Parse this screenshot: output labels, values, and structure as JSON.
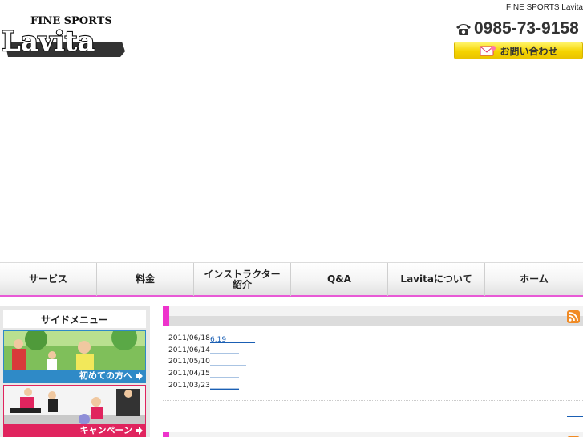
{
  "header": {
    "brand_text": "FINE SPORTS Lavita",
    "logo": {
      "top_text": "FINE SPORTS",
      "main_text": "Lavita"
    },
    "phone": "0985-73-9158",
    "phone_icon": "telephone-icon",
    "contact_label": "お問い合わせ",
    "contact_icon": "mail-icon"
  },
  "nav": {
    "items": [
      {
        "label": "サービス"
      },
      {
        "label": "料金"
      },
      {
        "label": "インストラクター\n紹介"
      },
      {
        "label": "Q&A"
      },
      {
        "label": "Lavitaについて"
      },
      {
        "label": "ホーム"
      }
    ]
  },
  "sidebar": {
    "title": "サイドメニュー",
    "banners": [
      {
        "label": "初めての方へ",
        "color": "#2f8ac7"
      },
      {
        "label": "キャンペーン",
        "color": "#e0245e"
      }
    ]
  },
  "main": {
    "accent_color": "#ee33cc",
    "news": [
      {
        "date": "2011/06/18",
        "link": "6.19＿＿＿＿"
      },
      {
        "date": "2011/06/14",
        "link": "＿＿＿＿"
      },
      {
        "date": "2011/05/10",
        "link": "＿＿＿＿＿"
      },
      {
        "date": "2011/04/15",
        "link": "＿＿＿＿"
      },
      {
        "date": "2011/03/23",
        "link": "＿＿＿＿"
      }
    ]
  }
}
